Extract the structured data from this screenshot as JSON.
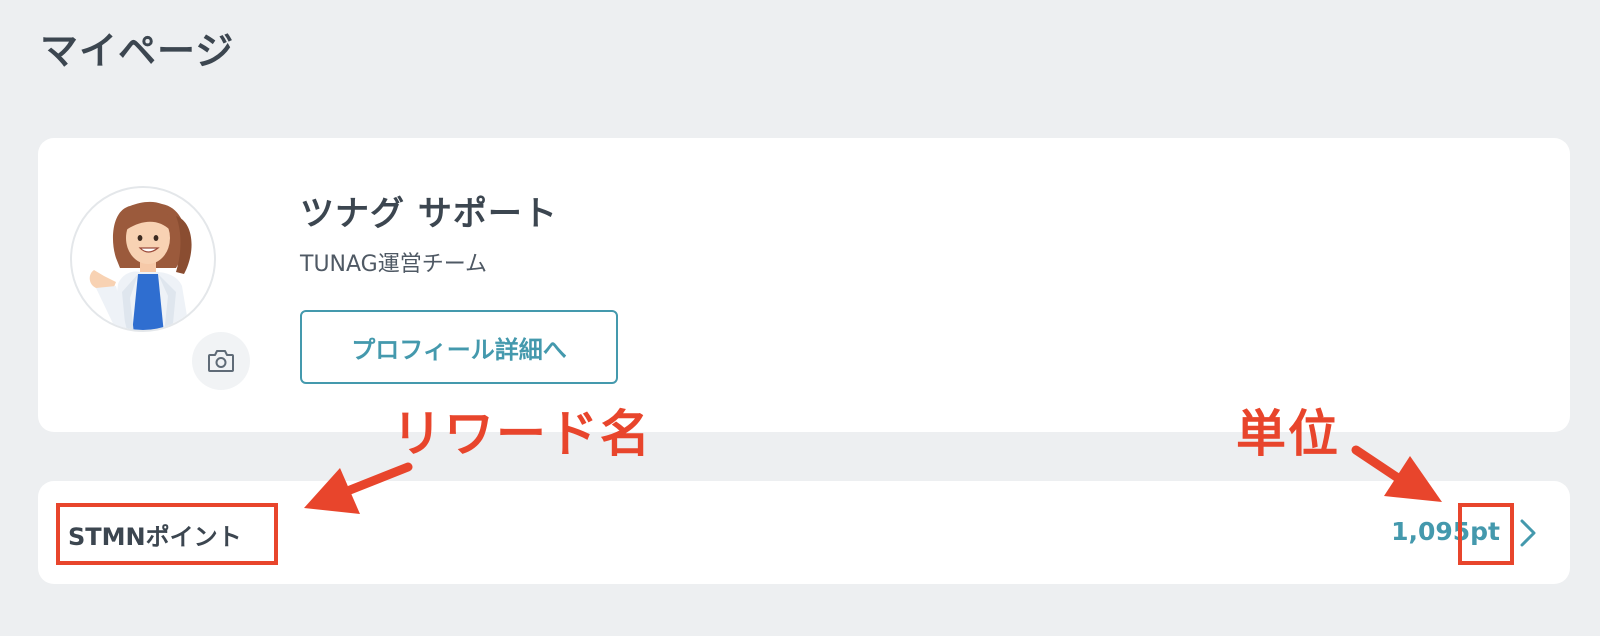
{
  "page": {
    "title": "マイページ"
  },
  "profile": {
    "name": "ツナグ サポート",
    "team": "TUNAG運営チーム",
    "detail_button_label": "プロフィール詳細へ",
    "avatar_icon": "user-avatar-illustration",
    "camera_icon": "camera-icon"
  },
  "reward": {
    "name": "STMNポイント",
    "amount": "1,095",
    "unit": "pt",
    "chevron_icon": "chevron-right-icon"
  },
  "annotations": {
    "reward_name_label": "リワード名",
    "unit_label": "単位",
    "color": "#e8452c"
  },
  "colors": {
    "background": "#edeff1",
    "card": "#ffffff",
    "accent": "#4499ad",
    "text": "#3c4650"
  }
}
